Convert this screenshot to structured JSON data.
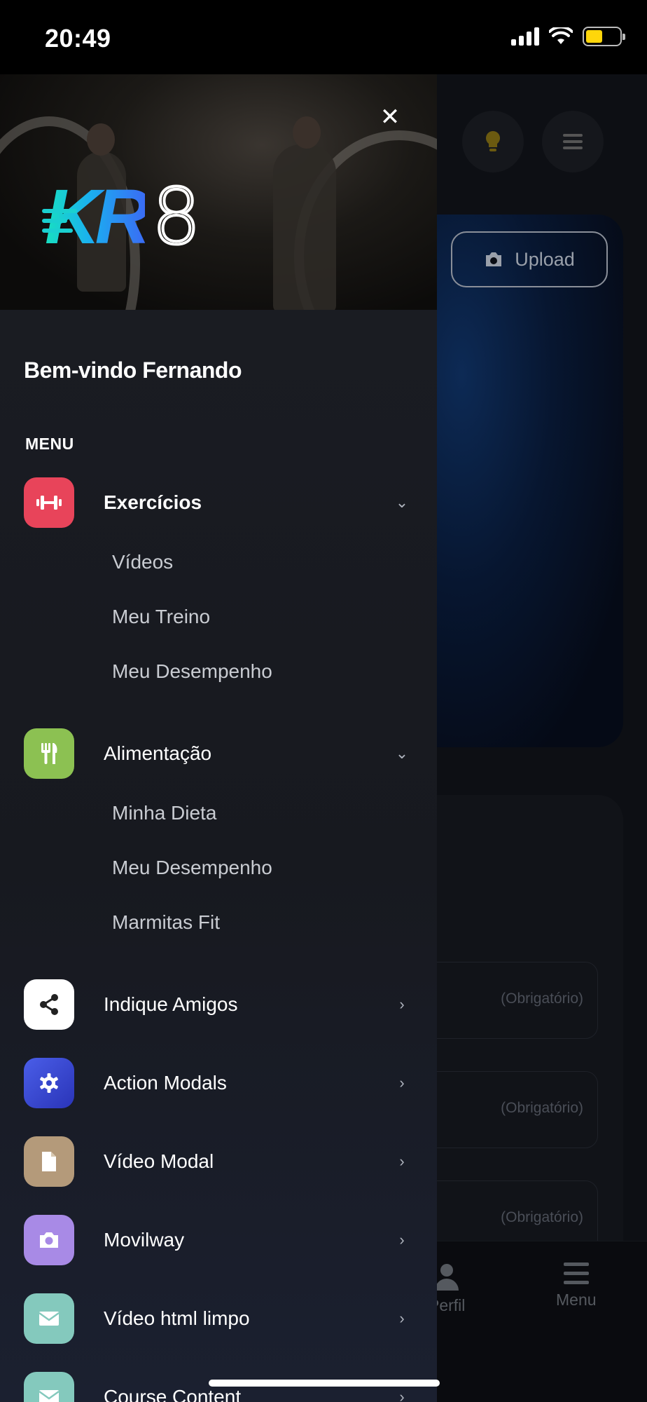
{
  "status": {
    "time": "20:49"
  },
  "background": {
    "upload_label": "Upload",
    "field_hint": "(Obrigatório)",
    "tabs": [
      {
        "label": "Perfil"
      },
      {
        "label": "Menu"
      }
    ]
  },
  "drawer": {
    "logo": "KR8",
    "welcome": "Bem-vindo Fernando",
    "menu_label": "MENU",
    "items": [
      {
        "label": "Exercícios",
        "icon": "dumbbell-icon",
        "color": "#e8445a",
        "expanded": true,
        "children": [
          "Vídeos",
          "Meu Treino",
          "Meu Desempenho"
        ]
      },
      {
        "label": "Alimentação",
        "icon": "utensils-icon",
        "color": "#8cc152",
        "expanded": true,
        "children": [
          "Minha Dieta",
          "Meu Desempenho",
          "Marmitas Fit"
        ]
      },
      {
        "label": "Indique Amigos",
        "icon": "share-icon",
        "color": "#ffffff"
      },
      {
        "label": "Action Modals",
        "icon": "gear-icon",
        "color": "#3c4fd8"
      },
      {
        "label": "Vídeo Modal",
        "icon": "file-icon",
        "color": "#b49a7a"
      },
      {
        "label": "Movilway",
        "icon": "camera-icon",
        "color": "#a88ae6"
      },
      {
        "label": "Vídeo html limpo",
        "icon": "envelope-icon",
        "color": "#84c9bd"
      },
      {
        "label": "Course Content",
        "icon": "envelope-icon",
        "color": "#84c9bd"
      }
    ]
  }
}
